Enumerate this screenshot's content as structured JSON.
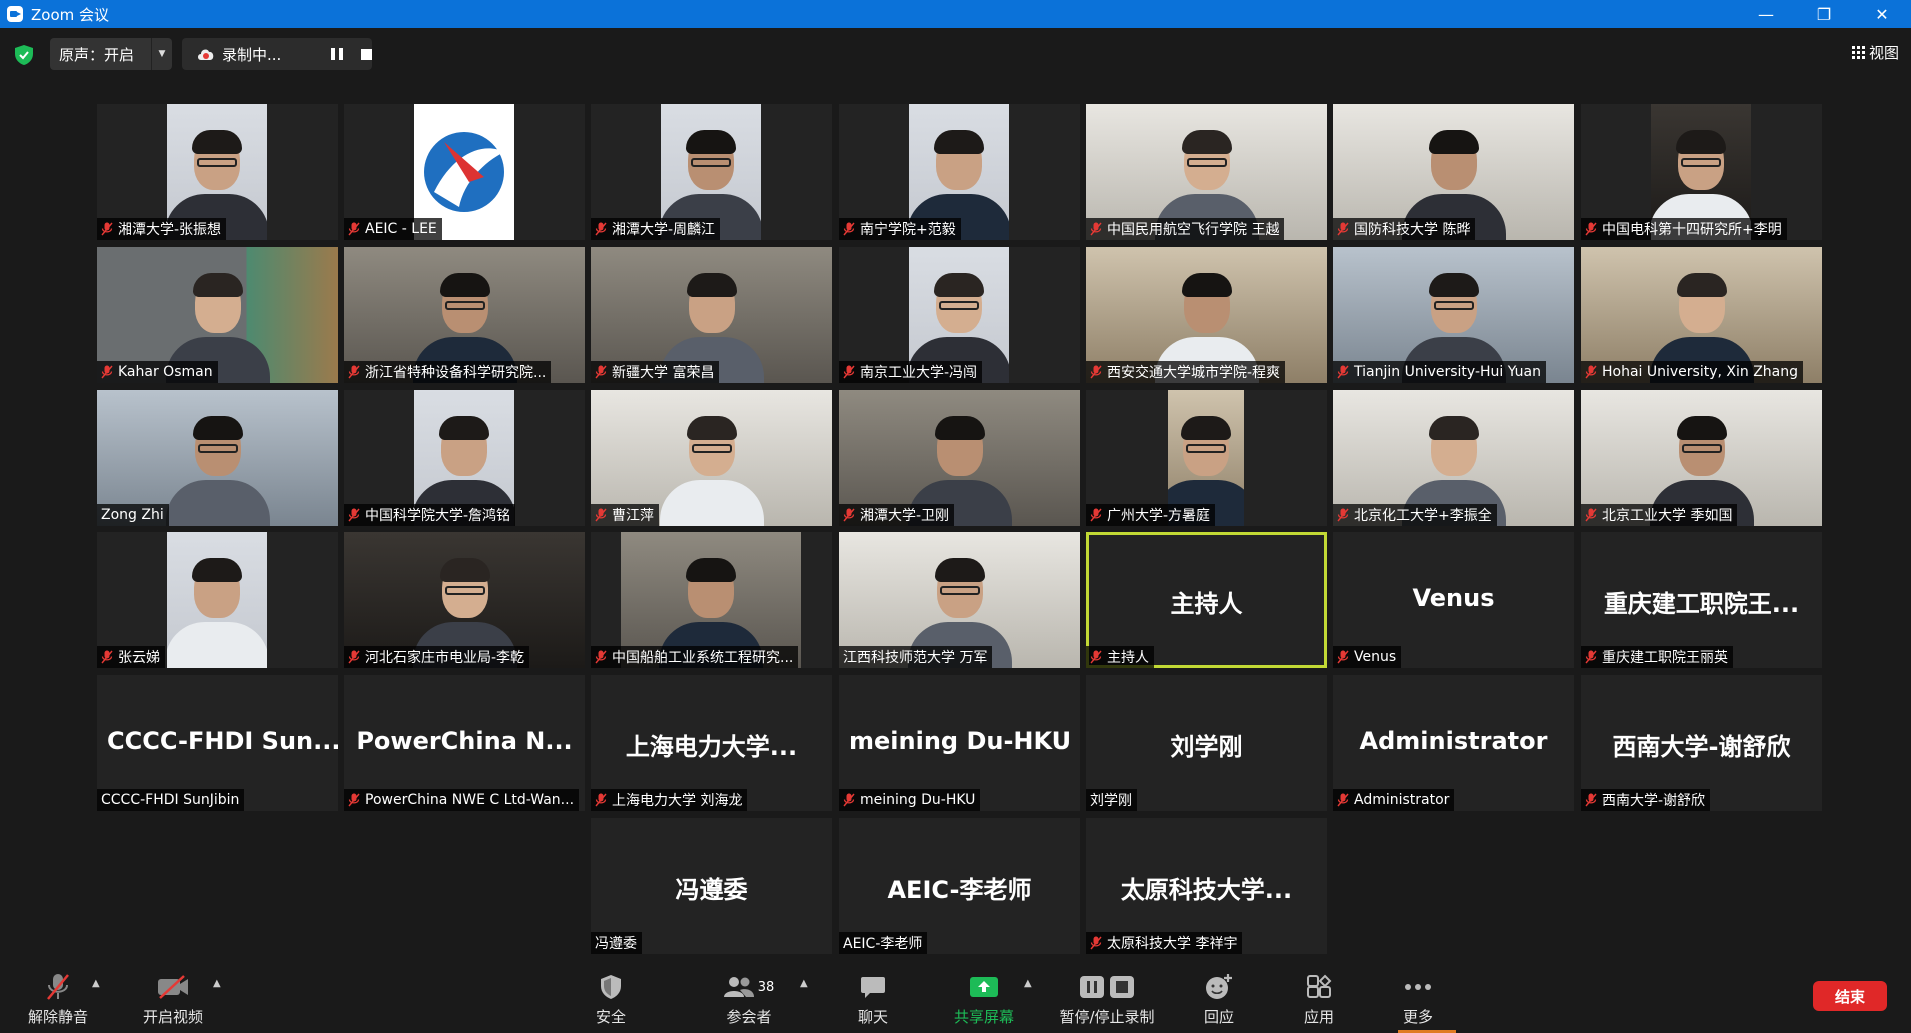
{
  "window": {
    "title": "Zoom 会议",
    "minimize": "—",
    "restore": "❐",
    "close": "✕"
  },
  "topbar": {
    "audio_label": "原声：开启",
    "recording_label": "录制中...",
    "view_label": "视图"
  },
  "participants": [
    {
      "tile": "张振想",
      "label": "湘潭大学-张振想",
      "muted": true,
      "video": true
    },
    {
      "tile": "AEIC - LEE",
      "label": "AEIC - LEE",
      "muted": true,
      "video": true
    },
    {
      "tile": "周麟江",
      "label": "湘潭大学-周麟江",
      "muted": true,
      "video": true
    },
    {
      "tile": "范毅",
      "label": "南宁学院+范毅",
      "muted": true,
      "video": true
    },
    {
      "tile": "王越",
      "label": "中国民用航空飞行学院 王越",
      "muted": true,
      "video": true
    },
    {
      "tile": "陈晔",
      "label": "国防科技大学 陈晔",
      "muted": true,
      "video": true
    },
    {
      "tile": "李明",
      "label": "中国电科第十四研究所+李明",
      "muted": true,
      "video": true
    },
    {
      "tile": "Kahar Osman",
      "label": "Kahar Osman",
      "muted": true,
      "video": true
    },
    {
      "tile": "浙江",
      "label": "浙江省特种设备科学研究院...",
      "muted": true,
      "video": true
    },
    {
      "tile": "富荣昌",
      "label": "新疆大学 富荣昌",
      "muted": true,
      "video": true
    },
    {
      "tile": "冯闯",
      "label": "南京工业大学-冯闯",
      "muted": true,
      "video": true
    },
    {
      "tile": "程爽",
      "label": "西安交通大学城市学院-程爽",
      "muted": true,
      "video": true
    },
    {
      "tile": "Hui Yuan",
      "label": "Tianjin University-Hui Yuan",
      "muted": true,
      "video": true
    },
    {
      "tile": "Xin Zhang",
      "label": "Hohai University, Xin Zhang",
      "muted": true,
      "video": true
    },
    {
      "tile": "Zong Zhi",
      "label": "Zong Zhi",
      "muted": false,
      "video": true
    },
    {
      "tile": "詹鸿铭",
      "label": "中国科学院大学-詹鸿铭",
      "muted": true,
      "video": true
    },
    {
      "tile": "曹江萍",
      "label": "曹江萍",
      "muted": true,
      "video": true
    },
    {
      "tile": "卫刚",
      "label": "湘潭大学-卫刚",
      "muted": true,
      "video": true
    },
    {
      "tile": "方暑庭",
      "label": "广州大学-方暑庭",
      "muted": true,
      "video": true
    },
    {
      "tile": "李振全",
      "label": "北京化工大学+李振全",
      "muted": true,
      "video": true
    },
    {
      "tile": "季如国",
      "label": "北京工业大学 季如国",
      "muted": true,
      "video": true
    },
    {
      "tile": "张云娣",
      "label": "张云娣",
      "muted": true,
      "video": true
    },
    {
      "tile": "李乾",
      "label": "河北石家庄市电业局-李乾",
      "muted": true,
      "video": true
    },
    {
      "tile": "中国船舶",
      "label": "中国船舶工业系统工程研究...",
      "muted": true,
      "video": true
    },
    {
      "tile": "万军",
      "label": "江西科技师范大学 万军",
      "muted": false,
      "video": true
    },
    {
      "tile": "主持人",
      "label": "主持人",
      "muted": true,
      "video": false,
      "active": true
    },
    {
      "tile": "Venus",
      "label": "Venus",
      "muted": true,
      "video": false
    },
    {
      "tile": "重庆建工职院王...",
      "label": "重庆建工职院王丽英",
      "muted": true,
      "video": false
    },
    {
      "tile": "CCCC-FHDI Sun...",
      "label": "CCCC-FHDI SunJibin",
      "muted": false,
      "video": false
    },
    {
      "tile": "PowerChina N...",
      "label": "PowerChina NWE C Ltd-Wan...",
      "muted": true,
      "video": false
    },
    {
      "tile": "上海电力大学...",
      "label": "上海电力大学 刘海龙",
      "muted": true,
      "video": false
    },
    {
      "tile": "meining Du-HKU",
      "label": "meining Du-HKU",
      "muted": true,
      "video": false
    },
    {
      "tile": "刘学刚",
      "label": "刘学刚",
      "muted": false,
      "video": false
    },
    {
      "tile": "Administrator",
      "label": "Administrator",
      "muted": true,
      "video": false
    },
    {
      "tile": "西南大学-谢舒欣",
      "label": "西南大学-谢舒欣",
      "muted": true,
      "video": false
    },
    {
      "tile": "冯遵委",
      "label": "冯遵委",
      "muted": false,
      "video": false
    },
    {
      "tile": "AEIC-李老师",
      "label": "AEIC-李老师",
      "muted": false,
      "video": false
    },
    {
      "tile": "太原科技大学...",
      "label": "太原科技大学 李祥宇",
      "muted": true,
      "video": false
    }
  ],
  "toolbar": {
    "unmute": "解除静音",
    "start_video": "开启视频",
    "security": "安全",
    "participants": "参会者",
    "participant_count": "38",
    "chat": "聊天",
    "share_screen": "共享屏幕",
    "pause_stop_recording": "暂停/停止录制",
    "reactions": "回应",
    "apps": "应用",
    "more": "更多",
    "end": "结束"
  },
  "colors": {
    "titlebar": "#0b72d9",
    "active_speaker": "#c2d935",
    "share_green": "#1dbb57",
    "end_red": "#e02828",
    "muted_red": "#e53935"
  }
}
